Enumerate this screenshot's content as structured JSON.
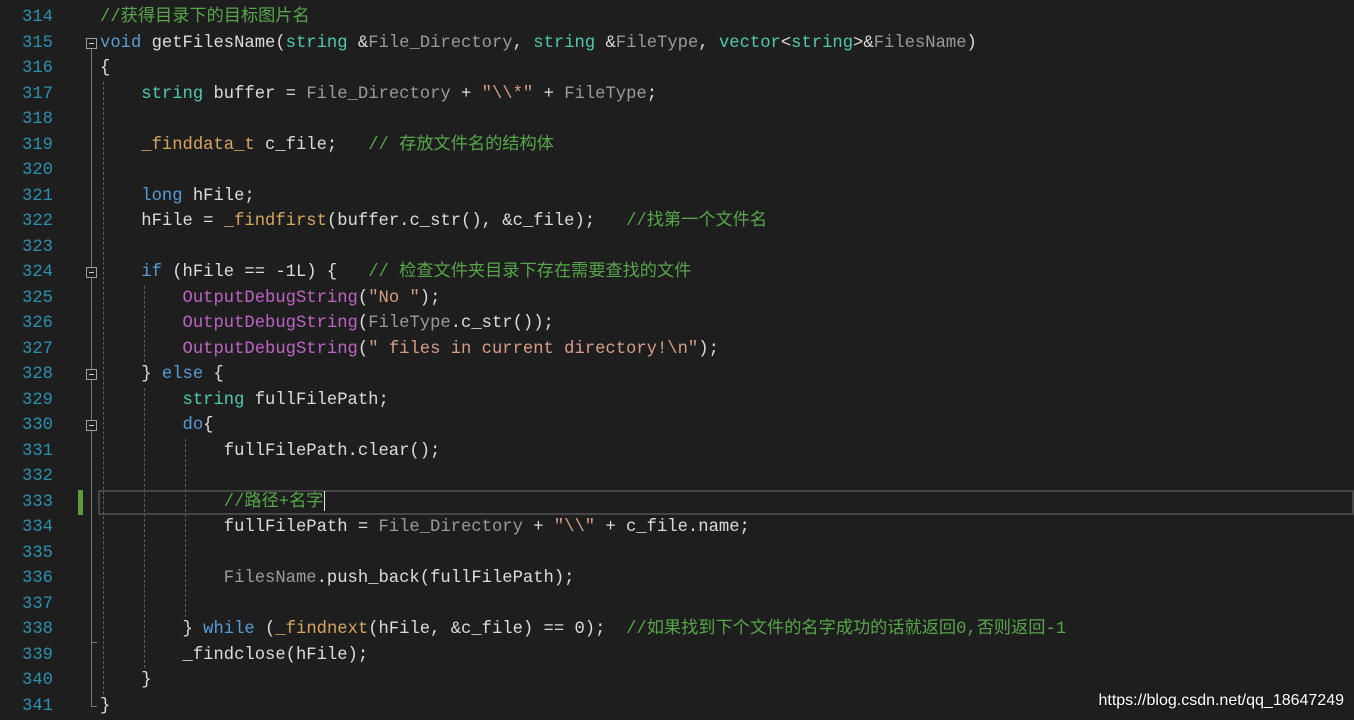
{
  "colors": {
    "background": "#1e1e1e",
    "line_number": "#2b91af",
    "text": "#dcdcdc",
    "change_marker": "#5e9b3d",
    "current_line_border": "#464646"
  },
  "editor": {
    "lines": [
      {
        "number": "314",
        "tokens": [
          {
            "text": "//获得目录下的目标图片名",
            "color": "#57a64a"
          }
        ]
      },
      {
        "number": "315",
        "fold_icon": "collapse-minus-icon",
        "tokens": [
          {
            "text": "void",
            "color": "#569cd6"
          },
          {
            "text": " getFilesName("
          },
          {
            "text": "string",
            "color": "#4ec9b0"
          },
          {
            "text": " &"
          },
          {
            "text": "File_Directory",
            "color": "#9a9a9a"
          },
          {
            "text": ", "
          },
          {
            "text": "string",
            "color": "#4ec9b0"
          },
          {
            "text": " &"
          },
          {
            "text": "FileType",
            "color": "#9a9a9a"
          },
          {
            "text": ", "
          },
          {
            "text": "vector",
            "color": "#4ec9b0"
          },
          {
            "text": "<"
          },
          {
            "text": "string",
            "color": "#4ec9b0"
          },
          {
            "text": ">&"
          },
          {
            "text": "FilesName",
            "color": "#9a9a9a"
          },
          {
            "text": ")"
          }
        ]
      },
      {
        "number": "316",
        "tokens": [
          {
            "text": "{"
          }
        ]
      },
      {
        "number": "317",
        "tokens": [
          {
            "text": "    "
          },
          {
            "text": "string",
            "color": "#4ec9b0"
          },
          {
            "text": " buffer = "
          },
          {
            "text": "File_Directory",
            "color": "#9a9a9a"
          },
          {
            "text": " + "
          },
          {
            "text": "\"\\\\*\"",
            "color": "#d69d85"
          },
          {
            "text": " + "
          },
          {
            "text": "FileType",
            "color": "#9a9a9a"
          },
          {
            "text": ";"
          }
        ]
      },
      {
        "number": "318",
        "tokens": []
      },
      {
        "number": "319",
        "tokens": [
          {
            "text": "    "
          },
          {
            "text": "_finddata_t",
            "color": "#d7a55e"
          },
          {
            "text": " c_file;   "
          },
          {
            "text": "// 存放文件名的结构体",
            "color": "#57a64a"
          }
        ]
      },
      {
        "number": "320",
        "tokens": []
      },
      {
        "number": "321",
        "tokens": [
          {
            "text": "    "
          },
          {
            "text": "long",
            "color": "#569cd6"
          },
          {
            "text": " hFile;"
          }
        ]
      },
      {
        "number": "322",
        "tokens": [
          {
            "text": "    hFile = "
          },
          {
            "text": "_findfirst",
            "color": "#d7a55e"
          },
          {
            "text": "(buffer.c_str(), &c_file);   "
          },
          {
            "text": "//找第一个文件名",
            "color": "#57a64a"
          }
        ]
      },
      {
        "number": "323",
        "tokens": []
      },
      {
        "number": "324",
        "fold_icon": "collapse-minus-icon",
        "tokens": [
          {
            "text": "    "
          },
          {
            "text": "if",
            "color": "#569cd6"
          },
          {
            "text": " (hFile == -1L) {   "
          },
          {
            "text": "// 检查文件夹目录下存在需要查找的文件",
            "color": "#57a64a"
          }
        ]
      },
      {
        "number": "325",
        "tokens": [
          {
            "text": "        "
          },
          {
            "text": "OutputDebugString",
            "color": "#bd63c5"
          },
          {
            "text": "("
          },
          {
            "text": "\"No \"",
            "color": "#d69d85"
          },
          {
            "text": ");"
          }
        ]
      },
      {
        "number": "326",
        "tokens": [
          {
            "text": "        "
          },
          {
            "text": "OutputDebugString",
            "color": "#bd63c5"
          },
          {
            "text": "("
          },
          {
            "text": "FileType",
            "color": "#9a9a9a"
          },
          {
            "text": ".c_str());"
          }
        ]
      },
      {
        "number": "327",
        "tokens": [
          {
            "text": "        "
          },
          {
            "text": "OutputDebugString",
            "color": "#bd63c5"
          },
          {
            "text": "("
          },
          {
            "text": "\" files in current directory!\\n\"",
            "color": "#d69d85"
          },
          {
            "text": ");"
          }
        ]
      },
      {
        "number": "328",
        "fold_icon": "collapse-minus-icon",
        "tokens": [
          {
            "text": "    } "
          },
          {
            "text": "else",
            "color": "#569cd6"
          },
          {
            "text": " {"
          }
        ]
      },
      {
        "number": "329",
        "tokens": [
          {
            "text": "        "
          },
          {
            "text": "string",
            "color": "#4ec9b0"
          },
          {
            "text": " fullFilePath;"
          }
        ]
      },
      {
        "number": "330",
        "fold_icon": "collapse-minus-icon",
        "tokens": [
          {
            "text": "        "
          },
          {
            "text": "do",
            "color": "#569cd6"
          },
          {
            "text": "{"
          }
        ]
      },
      {
        "number": "331",
        "tokens": [
          {
            "text": "            fullFilePath.clear();"
          }
        ]
      },
      {
        "number": "332",
        "tokens": []
      },
      {
        "number": "333",
        "current": true,
        "changed": true,
        "tokens": [
          {
            "text": "            "
          },
          {
            "text": "//路径+名字",
            "color": "#57a64a"
          }
        ]
      },
      {
        "number": "334",
        "tokens": [
          {
            "text": "            fullFilePath = "
          },
          {
            "text": "File_Directory",
            "color": "#9a9a9a"
          },
          {
            "text": " + "
          },
          {
            "text": "\"\\\\\"",
            "color": "#d69d85"
          },
          {
            "text": " + c_file.name;"
          }
        ]
      },
      {
        "number": "335",
        "tokens": []
      },
      {
        "number": "336",
        "tokens": [
          {
            "text": "            "
          },
          {
            "text": "FilesName",
            "color": "#9a9a9a"
          },
          {
            "text": ".push_back(fullFilePath);"
          }
        ]
      },
      {
        "number": "337",
        "tokens": []
      },
      {
        "number": "338",
        "tokens": [
          {
            "text": "        } "
          },
          {
            "text": "while",
            "color": "#569cd6"
          },
          {
            "text": " ("
          },
          {
            "text": "_findnext",
            "color": "#d7a55e"
          },
          {
            "text": "(hFile, &c_file) == 0);  "
          },
          {
            "text": "//如果找到下个文件的名字成功的话就返回0,否则返回-1",
            "color": "#57a64a"
          }
        ]
      },
      {
        "number": "339",
        "tokens": [
          {
            "text": "        _findclose(hFile);"
          }
        ]
      },
      {
        "number": "340",
        "tokens": [
          {
            "text": "    }"
          }
        ]
      },
      {
        "number": "341",
        "tokens": [
          {
            "text": "}"
          }
        ]
      }
    ]
  },
  "watermark": "https://blog.csdn.net/qq_18647249"
}
